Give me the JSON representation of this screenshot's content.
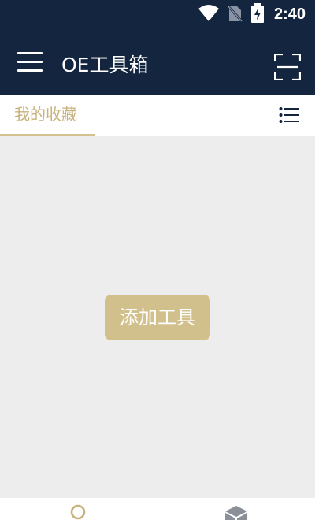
{
  "status_bar": {
    "time": "2:40",
    "icons": [
      "wifi-icon",
      "no-sim-icon",
      "battery-charging-icon"
    ]
  },
  "app_bar": {
    "title": "OE工具箱",
    "menu_icon": "hamburger-menu-icon",
    "scan_icon": "scan-frame-icon"
  },
  "tabs": [
    {
      "label": "我的收藏",
      "active": true
    }
  ],
  "list_icon": "list-view-icon",
  "main": {
    "add_tool_label": "添加工具"
  },
  "bottom_nav": {
    "items": [
      {
        "icon": "search-circle-icon",
        "active": true
      },
      {
        "icon": "box-icon",
        "active": false
      }
    ]
  },
  "colors": {
    "primary_dark": "#13253f",
    "accent_gold": "#d2c08c",
    "background": "#ededed"
  }
}
